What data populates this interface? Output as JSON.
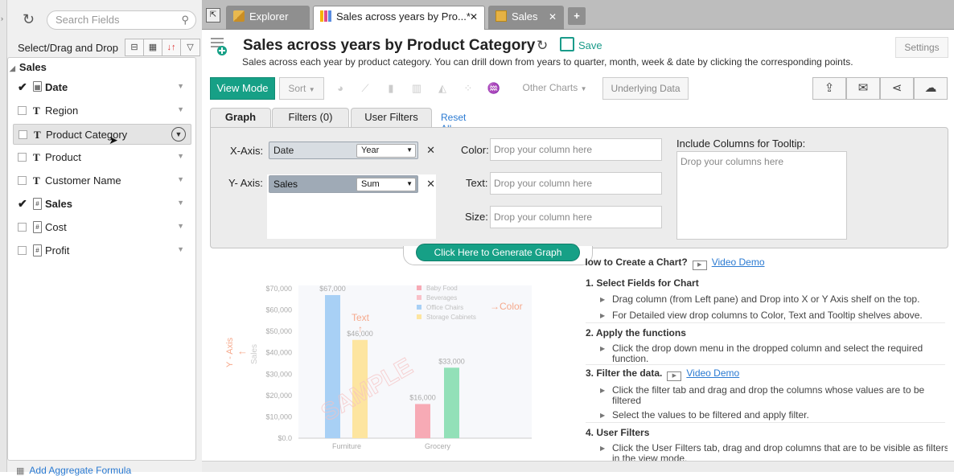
{
  "left": {
    "search_placeholder": "Search Fields",
    "select_label": "Select/Drag and Drop",
    "group": "Sales",
    "fields": [
      {
        "name": "Date",
        "type": "date",
        "checked": true,
        "bold": true
      },
      {
        "name": "Region",
        "type": "text",
        "checked": false,
        "bold": false
      },
      {
        "name": "Product Category",
        "type": "text",
        "checked": false,
        "bold": false,
        "highlighted": true
      },
      {
        "name": "Product",
        "type": "text",
        "checked": false,
        "bold": false
      },
      {
        "name": "Customer Name",
        "type": "text",
        "checked": false,
        "bold": false
      },
      {
        "name": "Sales",
        "type": "number",
        "checked": true,
        "bold": true
      },
      {
        "name": "Cost",
        "type": "number",
        "checked": false,
        "bold": false
      },
      {
        "name": "Profit",
        "type": "number",
        "checked": false,
        "bold": false
      }
    ],
    "add_formula": "Add Aggregate Formula"
  },
  "tabs": [
    {
      "label": "Explorer",
      "style": "dark",
      "closable": false
    },
    {
      "label": "Sales across years by Pro...*",
      "style": "active",
      "closable": true
    },
    {
      "label": "Sales",
      "style": "dark",
      "closable": true
    }
  ],
  "report": {
    "title": "Sales across years by Product Category",
    "save": "Save",
    "settings": "Settings",
    "description": "Sales across each year by product category. You can drill down from years to quarter, month, week & date by clicking the corresponding points."
  },
  "toolbar": {
    "view_mode": "View Mode",
    "sort": "Sort",
    "other_charts": "Other Charts",
    "underlying_data": "Underlying Data"
  },
  "shelf": {
    "tabs": [
      "Graph",
      "Filters (0)",
      "User Filters"
    ],
    "reset_all": "Reset All",
    "x_axis_label": "X-Axis:",
    "x_field": "Date",
    "x_func": "Year",
    "y_axis_label": "Y- Axis:",
    "y_field": "Sales",
    "y_func": "Sum",
    "color_label": "Color:",
    "text_label": "Text:",
    "size_label": "Size:",
    "drop_column": "Drop your column here",
    "tooltip_label": "Include Columns for Tooltip:",
    "drop_columns": "Drop your columns here",
    "generate": "Click Here to Generate Graph"
  },
  "sample_chart": {
    "y_ticks": [
      "$70,000",
      "$60,000",
      "$50,000",
      "$40,000",
      "$30,000",
      "$20,000",
      "$10,000",
      "$0.0"
    ],
    "categories": [
      "Furniture",
      "Grocery"
    ],
    "bars": [
      {
        "value": 67000,
        "label": "$67,000",
        "color": "#a8d0f5"
      },
      {
        "value": 46000,
        "label": "$46,000",
        "color": "#fde5a0"
      },
      {
        "value": 16000,
        "label": "$16,000",
        "color": "#f7aab5"
      },
      {
        "value": 33000,
        "label": "$33,000",
        "color": "#92e0b8"
      }
    ],
    "legend": [
      {
        "name": "Baby Food",
        "color": "#f7aab5"
      },
      {
        "name": "Beverages",
        "color": "#f9c1c9"
      },
      {
        "name": "Office Chairs",
        "color": "#a8d0f5"
      },
      {
        "name": "Storage Cabinets",
        "color": "#fde5a0"
      }
    ],
    "annotation_text": "Text",
    "annotation_color": "Color",
    "annotation_yaxis": "Y - Axis",
    "annotation_sales": "Sales",
    "watermark": "SAMPLE"
  },
  "help": {
    "title": "How to Create a Chart?",
    "video_demo": "Video Demo",
    "step1": "1. Select Fields for Chart",
    "step1_a": "Drag column (from Left pane) and Drop into X or Y Axis shelf on the top.",
    "step1_b": "For Detailed view drop columns to Color, Text and Tooltip shelves above.",
    "step2": "2. Apply the functions",
    "step2_a": "Click the drop down menu in the dropped column and select the required function.",
    "step3": "3. Filter the data.",
    "step3_a": "Click the filter tab and drag and drop the columns whose values are to be filtered",
    "step3_b": "Select the values to be filtered and apply filter.",
    "step4": "4. User Filters",
    "step4_a": "Click the User Filters tab, drag and drop columns that are to be visible as filters in the view mode."
  },
  "colors": {
    "accent": "#16a086",
    "link": "#2a7ad2"
  }
}
